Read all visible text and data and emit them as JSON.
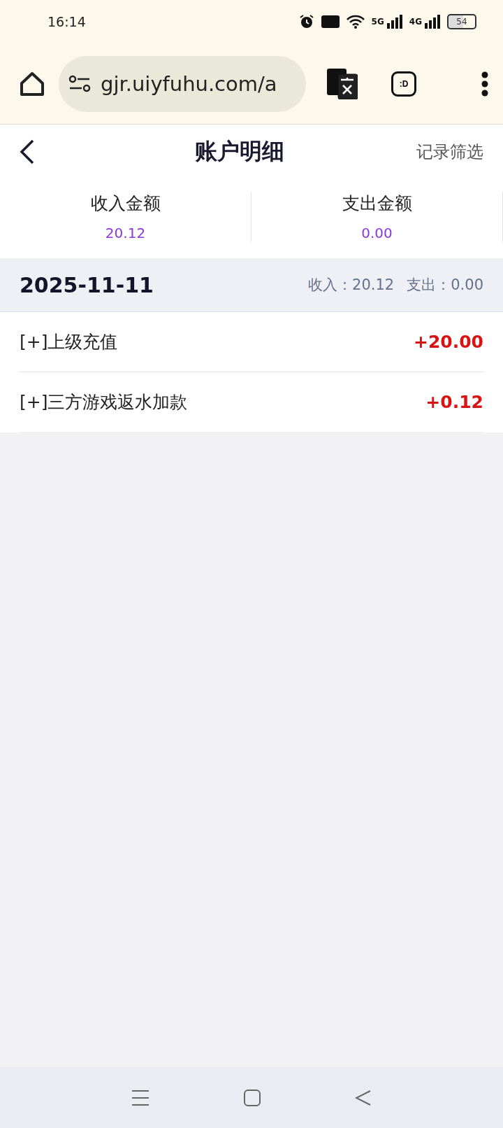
{
  "status_bar": {
    "time": "16:14",
    "network_1": "5G",
    "network_2": "4G",
    "battery": "54"
  },
  "browser": {
    "url": "gjr.uiyfuhu.com/a",
    "tabs_label": ":D"
  },
  "header": {
    "title": "账户明细",
    "action": "记录筛选"
  },
  "summary": [
    {
      "label": "收入金额",
      "value": "20.12"
    },
    {
      "label": "支出金额",
      "value": "0.00"
    }
  ],
  "groups": [
    {
      "date": "2025-11-11",
      "income": "收入：20.12",
      "expense": "支出：0.00",
      "records": [
        {
          "name": "[+]上级充值",
          "amount": "+20.00"
        },
        {
          "name": "[+]三方游戏返水加款",
          "amount": "+0.12"
        }
      ]
    }
  ]
}
